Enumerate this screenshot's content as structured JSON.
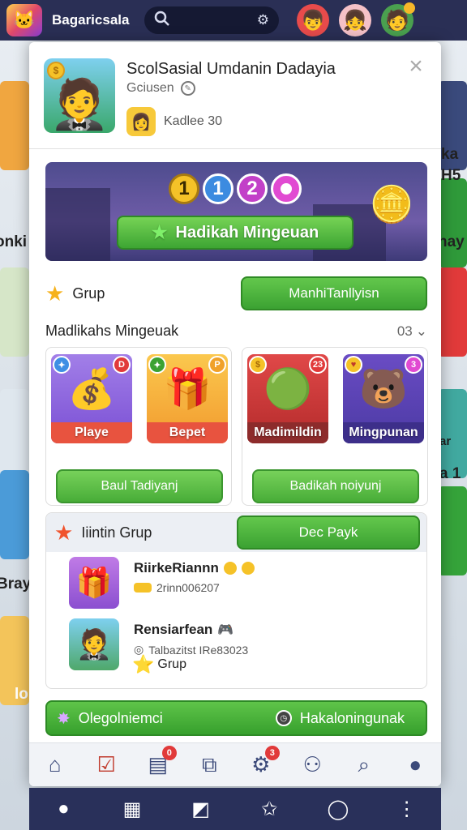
{
  "topbar": {
    "app_name": "Bagaricsala",
    "search_icon": "search-icon",
    "settings_icon": "gear-icon"
  },
  "background": {
    "left_texts": [
      "onki",
      "Bray",
      "lo"
    ],
    "right_texts": [
      "ka",
      "H5",
      "nay",
      "a 1",
      "ar"
    ]
  },
  "profile": {
    "name": "ScolSasial Umdanin Dadayia",
    "subtitle": "Gciusen",
    "level_text": "Kadlee 30",
    "close_label": "×"
  },
  "banner": {
    "steps": [
      "1",
      "1",
      "2"
    ],
    "button_label": "Hadikah Mingeuan"
  },
  "group_row": {
    "label": "Grup",
    "button_label": "ManhiTanllyisn"
  },
  "rewards": {
    "title": "Madlikahs Mingeuak",
    "count": "03",
    "left_card": {
      "tiles": [
        {
          "caption": "Playe",
          "badge": "D"
        },
        {
          "caption": "Bepet",
          "badge": "P"
        }
      ],
      "button_label": "Baul Tadiyanj"
    },
    "right_card": {
      "tiles": [
        {
          "caption": "Madimildin",
          "badge": "23"
        },
        {
          "caption": "Mingpunan",
          "badge": "3"
        }
      ],
      "button_label": "Badikah noiyunj"
    }
  },
  "invite": {
    "title": "Iiintin Grup",
    "button_label": "Dec Payk",
    "friends": [
      {
        "name": "RiirkeRiannn",
        "sub": "2rinn006207"
      },
      {
        "name": "Rensiarfean",
        "sub": "Talbazitst IRe83023"
      }
    ],
    "group_label": "Grup"
  },
  "footer_bar": {
    "left_label": "Olegolniemci",
    "right_label": "Hakaloningunak"
  },
  "modal_tabs": [
    {
      "icon": "home-icon",
      "badge": ""
    },
    {
      "icon": "checklist-icon",
      "badge": ""
    },
    {
      "icon": "document-icon",
      "badge": "0"
    },
    {
      "icon": "gift-icon",
      "badge": ""
    },
    {
      "icon": "gear-icon",
      "badge": "3"
    },
    {
      "icon": "people-icon",
      "badge": ""
    },
    {
      "icon": "search-icon",
      "badge": ""
    },
    {
      "icon": "user-icon",
      "badge": ""
    }
  ],
  "bottom_nav": [
    "user-icon",
    "calendar-icon",
    "chart-icon",
    "star-icon",
    "profile-icon",
    "more-icon"
  ],
  "colors": {
    "topbar": "#2a2f55",
    "primary_green": "#3ba232",
    "accent_gold": "#f5c228"
  }
}
